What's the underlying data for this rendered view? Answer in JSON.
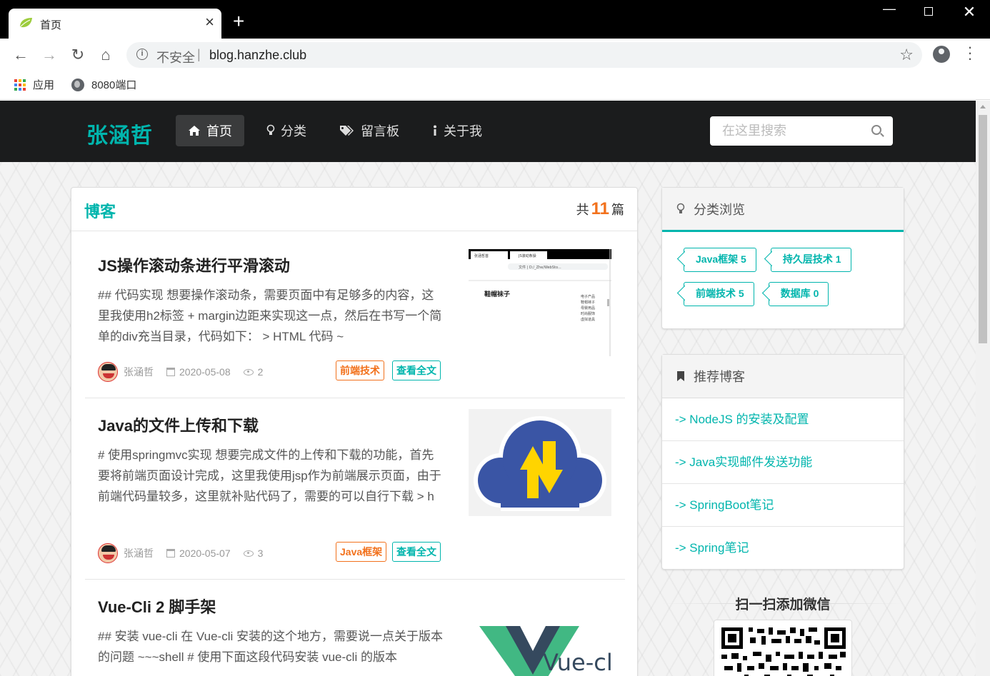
{
  "browser": {
    "tab_title": "首页",
    "tab_close": "×",
    "new_tab": "+",
    "url_security": "不安全",
    "url_separator": "|",
    "url": "blog.hanzhe.club",
    "bookmarks": [
      {
        "label": "应用",
        "icon": "apps-grid-icon"
      },
      {
        "label": "8080端口",
        "icon": "globe-icon"
      }
    ],
    "nav_icons": [
      "back-arrow-icon",
      "forward-arrow-icon",
      "reload-icon",
      "home-icon"
    ],
    "window_controls": {
      "minimize": "—",
      "close": "✕"
    }
  },
  "site": {
    "logo": "张涵哲",
    "menu": [
      {
        "label": "首页",
        "icon": "home-icon",
        "active": true
      },
      {
        "label": "分类",
        "icon": "lightbulb-icon",
        "active": false
      },
      {
        "label": "留言板",
        "icon": "tags-icon",
        "active": false
      },
      {
        "label": "关于我",
        "icon": "info-icon",
        "active": false
      }
    ],
    "search_placeholder": "在这里搜索"
  },
  "blog": {
    "title": "博客",
    "count_prefix": "共",
    "count": "11",
    "count_suffix": "篇",
    "posts": [
      {
        "title": "JS操作滚动条进行平滑滚动",
        "excerpt": "## 代码实现 想要操作滚动条，需要页面中有足够多的内容，这里我使用h2标签 + margin边距来实现这一点，然后在书写一个简单的div充当目录，代码如下： > HTML 代码 ~",
        "author": "张涵哲",
        "date": "2020-05-08",
        "views": "2",
        "category": "前端技术",
        "read_more": "查看全文",
        "thumb_text": {
          "tab1": "张涵哲首",
          "tab2": "JS滚动条操",
          "url": "文件 | D:/_Zhe/WebSto...",
          "heading": "鞋帽袜子",
          "list": [
            "电子产品",
            "鞋帽袜子",
            "母婴用品",
            "时尚服饰",
            "虚拟道具"
          ]
        }
      },
      {
        "title": "Java的文件上传和下载",
        "excerpt": "# 使用springmvc实现 想要完成文件的上传和下载的功能，首先要将前端页面设计完成，这里我使用jsp作为前端展示页面，由于前端代码量较多，这里就补贴代码了，需要的可以自行下载 > h",
        "author": "张涵哲",
        "date": "2020-05-07",
        "views": "3",
        "category": "Java框架",
        "read_more": "查看全文"
      },
      {
        "title": "Vue-Cli 2 脚手架",
        "excerpt": "## 安装 vue-cli 在 Vue-cli 安装的这个地方，需要说一点关于版本的问题 ~~~shell # 使用下面这段代码安装 vue-cli 的版本",
        "thumb_text": "Vue-cli"
      }
    ]
  },
  "sidebar": {
    "categories_title": "分类浏览",
    "categories": [
      {
        "label": "Java框架 5"
      },
      {
        "label": "持久层技术 1"
      },
      {
        "label": "前端技术 5"
      },
      {
        "label": "数据库 0"
      }
    ],
    "recommend_title": "推荐博客",
    "recommend": [
      "-> NodeJS 的安装及配置",
      "-> Java实现邮件发送功能",
      "-> SpringBoot笔记",
      "-> Spring笔记"
    ],
    "wechat_title": "扫一扫添加微信"
  },
  "colors": {
    "accent": "#00b5ad",
    "orange": "#f2711c",
    "nav_bg": "#1b1c1d"
  }
}
